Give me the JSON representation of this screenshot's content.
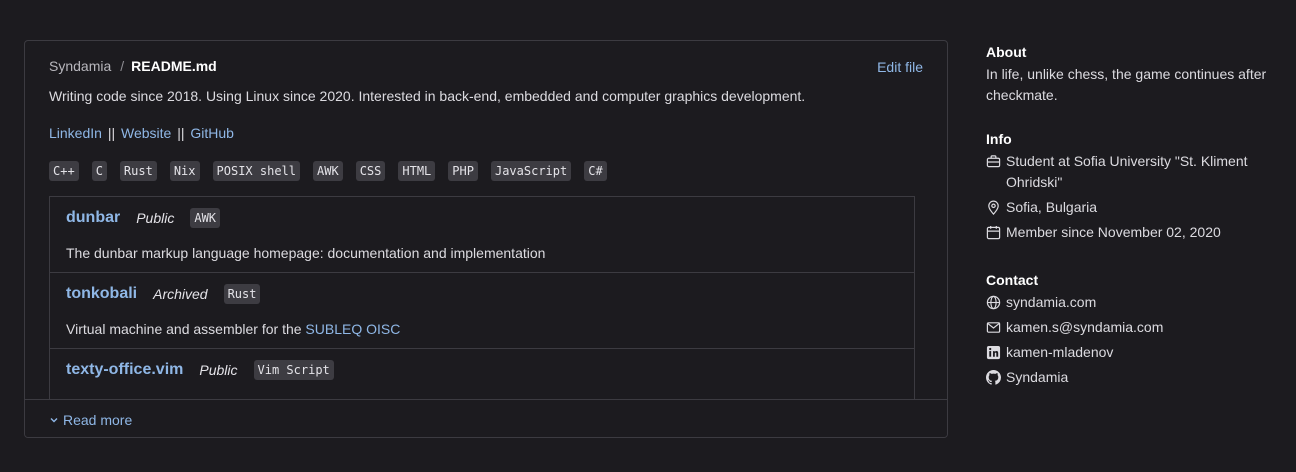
{
  "readme": {
    "owner": "Syndamia",
    "separator": "/",
    "file": "README.md",
    "edit_label": "Edit file",
    "bio": "Writing code since 2018. Using Linux since 2020. Interested in back-end, embedded and computer graphics development.",
    "links": [
      "LinkedIn",
      "Website",
      "GitHub"
    ],
    "link_separator": "||",
    "languages": [
      "C++",
      "C",
      "Rust",
      "Nix",
      "POSIX shell",
      "AWK",
      "CSS",
      "HTML",
      "PHP",
      "JavaScript",
      "C#"
    ],
    "repos": [
      {
        "name": "dunbar",
        "visibility": "Public",
        "language": "AWK",
        "description": "The dunbar markup language homepage: documentation and implementation",
        "description_link": ""
      },
      {
        "name": "tonkobali",
        "visibility": "Archived",
        "language": "Rust",
        "description": "Virtual machine and assembler for the ",
        "description_link": "SUBLEQ OISC"
      },
      {
        "name": "texty-office.vim",
        "visibility": "Public",
        "language": "Vim Script",
        "description": "",
        "description_link": ""
      }
    ],
    "read_more": "Read more"
  },
  "sidebar": {
    "about": {
      "heading": "About",
      "text": "In life, unlike chess, the game continues after checkmate."
    },
    "info": {
      "heading": "Info",
      "items": [
        {
          "icon": "briefcase-icon",
          "text": "Student at Sofia University \"St. Kliment Ohridski\""
        },
        {
          "icon": "location-pin-icon",
          "text": "Sofia, Bulgaria"
        },
        {
          "icon": "calendar-icon",
          "text": "Member since November 02, 2020"
        }
      ]
    },
    "contact": {
      "heading": "Contact",
      "items": [
        {
          "icon": "globe-icon",
          "text": "syndamia.com"
        },
        {
          "icon": "mail-icon",
          "text": "kamen.s@syndamia.com"
        },
        {
          "icon": "linkedin-icon",
          "text": "kamen-mladenov"
        },
        {
          "icon": "github-icon",
          "text": "Syndamia"
        }
      ]
    }
  },
  "colors": {
    "background": "#1c1b1f",
    "link": "#8fb7e6",
    "border": "#3c3b41",
    "tag_bg": "#3d3c42"
  }
}
